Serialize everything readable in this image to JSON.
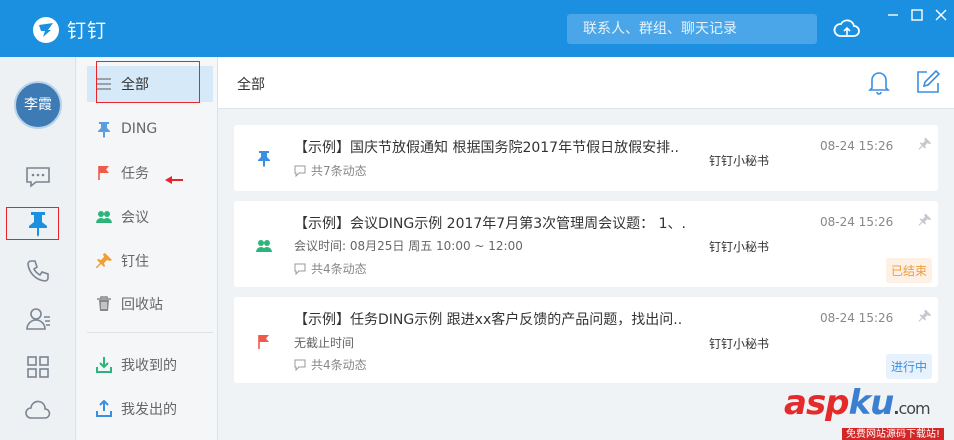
{
  "app": {
    "name": "钉钉",
    "search_placeholder": "联系人、群组、聊天记录"
  },
  "user": {
    "avatar_text": "李霞"
  },
  "menu": {
    "items": [
      {
        "label": "全部",
        "icon": "list-icon",
        "active": true
      },
      {
        "label": "DING",
        "icon": "pin-icon"
      },
      {
        "label": "任务",
        "icon": "flag-icon"
      },
      {
        "label": "会议",
        "icon": "people-icon"
      },
      {
        "label": "钉住",
        "icon": "pushpin-icon"
      },
      {
        "label": "回收站",
        "icon": "trash-icon"
      },
      {
        "label": "我收到的",
        "icon": "download-icon"
      },
      {
        "label": "我发出的",
        "icon": "upload-icon"
      }
    ]
  },
  "main": {
    "title": "全部",
    "cards": [
      {
        "title": "【示例】国庆节放假通知 根据国务院2017年节假日放假安排..",
        "sub": "",
        "meta": "共7条动态",
        "sender": "钉钉小秘书",
        "time": "08-24 15:26",
        "badge": "",
        "icon": "pin-icon",
        "icon_color": "#3a8fe0"
      },
      {
        "title": "【示例】会议DING示例 2017年7月第3次管理周会议题： 1、.",
        "sub": "会议时间: 08月25日 周五 10:00 ~ 12:00",
        "meta": "共4条动态",
        "sender": "钉钉小秘书",
        "time": "08-24 15:26",
        "badge": "已结束",
        "icon": "people-icon",
        "icon_color": "#2bb57a"
      },
      {
        "title": "【示例】任务DING示例 跟进xx客户反馈的产品问题，找出问..",
        "sub": "无截止时间",
        "meta": "共4条动态",
        "sender": "钉钉小秘书",
        "time": "08-24 15:26",
        "badge": "进行中",
        "icon": "flag-icon",
        "icon_color": "#f05a4a"
      }
    ]
  },
  "watermark": {
    "brand_a": "asp",
    "brand_b": "ku",
    "dot": ".",
    "tld": "com",
    "tagline": "免费网站源码下载站!"
  },
  "colors": {
    "titlebar": "#1b8fe0",
    "accent": "#3a8fe0",
    "annotation": "#e8242a"
  }
}
